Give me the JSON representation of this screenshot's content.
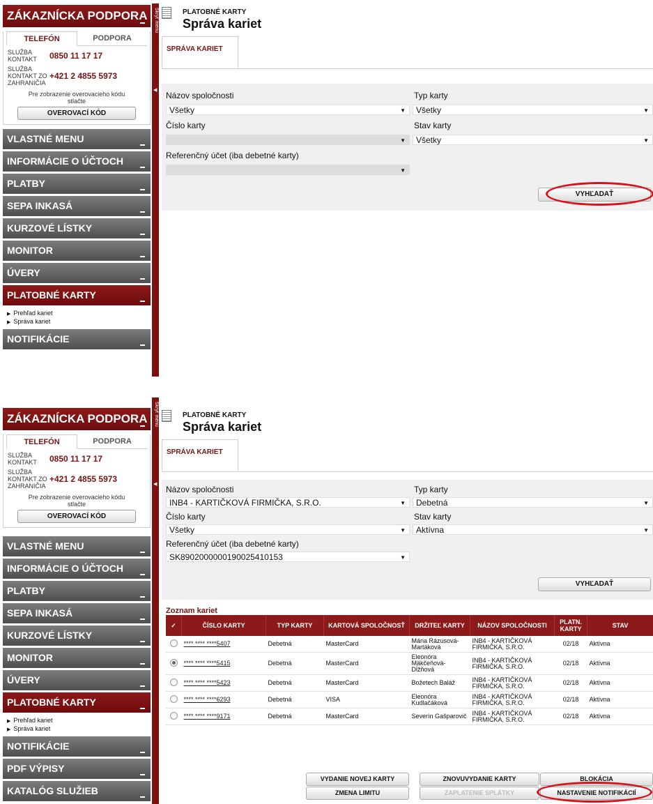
{
  "sidebar": {
    "support_title": "ZÁKAZNÍCKA PODPORA",
    "tabs": [
      "TELEFÓN",
      "PODPORA"
    ],
    "contacts": [
      {
        "label": "SLUŽBA KONTAKT",
        "value": "0850 11 17 17"
      },
      {
        "label": "SLUŽBA KONTAKT ZO ZAHRANIČIA",
        "value": "+421 2 4855 5973"
      }
    ],
    "verify_text": "Pre zobrazenie overovacieho kódu stlačte",
    "verify_button": "OVEROVACÍ KÓD",
    "menu": [
      "VLASTNÉ MENU",
      "INFORMÁCIE O ÚČTOCH",
      "PLATBY",
      "SEPA INKASÁ",
      "KURZOVÉ LÍSTKY",
      "MONITOR",
      "ÚVERY",
      "PLATOBNÉ KARTY",
      "NOTIFIKÁCIE",
      "PDF VÝPISY",
      "KATALÓG SLUŽIEB"
    ],
    "submenu": [
      "Prehľad kariet",
      "Správa kariet"
    ],
    "toggle_label": "Skryť menu"
  },
  "page": {
    "breadcrumb": "PLATOBNÉ KARTY",
    "title": "Správa kariet",
    "tab": "SPRÁVA KARIET"
  },
  "filters_labels": {
    "company": "Názov spoločnosti",
    "card_type": "Typ karty",
    "card_number": "Číslo karty",
    "card_status": "Stav karty",
    "ref_account": "Referenčný účet (iba debetné karty)",
    "search": "VYHĽADAŤ"
  },
  "panel1": {
    "company": "Všetky",
    "card_type": "Všetky",
    "card_number": "",
    "card_status": "Všetky",
    "ref_account": ""
  },
  "panel2": {
    "company": "INB4 - KARTIČKOVÁ FIRMIČKA, S.R.O.",
    "card_type": "Debetná",
    "card_number": "Všetky",
    "card_status": "Aktívna",
    "ref_account": "SK8902000000190025410153",
    "list_title": "Zoznam kariet",
    "columns": [
      "✓",
      "ČÍSLO KARTY",
      "TYP KARTY",
      "KARTOVÁ SPOLOČNOSŤ",
      "DRŽITEĽ KARTY",
      "NÁZOV SPOLOČNOSTI",
      "PLATN. KARTY",
      "STAV"
    ],
    "rows": [
      {
        "selected": false,
        "number": "**** **** ****5407",
        "type": "Debetná",
        "company": "MasterCard",
        "holder": "Mária Rázusová-Martáková",
        "firm": "INB4 - KARTIČKOVÁ FIRMIČKA, S.R.O.",
        "valid": "02/18",
        "status": "Aktívna"
      },
      {
        "selected": true,
        "number": "**** **** ****5415",
        "type": "Debetná",
        "company": "MasterCard",
        "holder": "Eleonóra Mäkčeňová-Dĺžňová",
        "firm": "INB4 - KARTIČKOVÁ FIRMIČKA, S.R.O.",
        "valid": "02/18",
        "status": "Aktívna"
      },
      {
        "selected": false,
        "number": "**** **** ****5423",
        "type": "Debetná",
        "company": "MasterCard",
        "holder": "Božetech Baláž",
        "firm": "INB4 - KARTIČKOVÁ FIRMIČKA, S.R.O.",
        "valid": "02/18",
        "status": "Aktívna"
      },
      {
        "selected": false,
        "number": "**** **** ****6293",
        "type": "Debetná",
        "company": "VISA",
        "holder": "Eleonóra Kudlačáková",
        "firm": "INB4 - KARTIČKOVÁ FIRMIČKA, S.R.O.",
        "valid": "02/18",
        "status": "Aktívna"
      },
      {
        "selected": false,
        "number": "**** **** ****9171",
        "type": "Debetná",
        "company": "MasterCard",
        "holder": "Severín Gašparovič",
        "firm": "INB4 - KARTIČKOVÁ FIRMIČKA, S.R.O.",
        "valid": "02/18",
        "status": "Aktívna"
      }
    ],
    "actions": [
      "VYDANIE NOVEJ KARTY",
      "ZNOVUVYDANIE KARTY",
      "BLOKÁCIA",
      "ZMENA LIMITU",
      "ZAPLATENIE SPLÁTKY",
      "NASTAVENIE NOTIFIKÁCIÍ"
    ]
  },
  "colors": {
    "brand": "#7a1212",
    "highlight": "#d6121b",
    "menu_gray": "#5a5a5a"
  }
}
